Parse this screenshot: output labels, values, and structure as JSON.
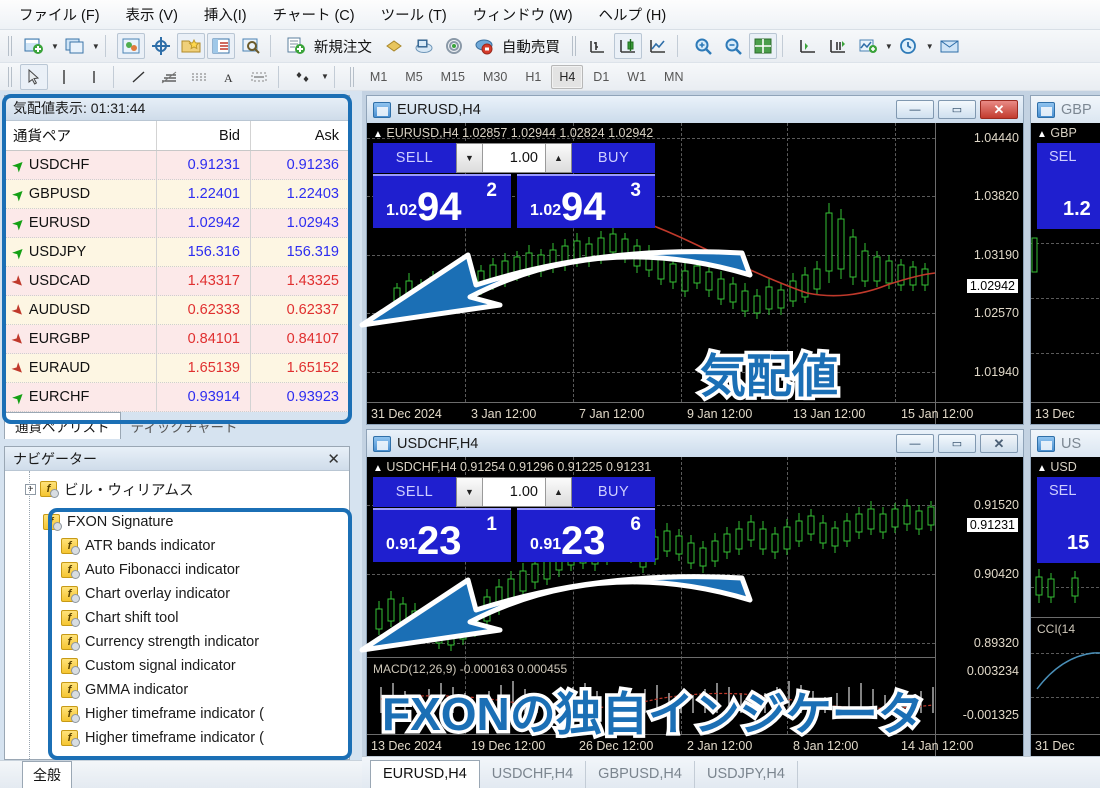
{
  "menu": {
    "items": [
      "ファイル (F)",
      "表示 (V)",
      "挿入(I)",
      "チャート (C)",
      "ツール (T)",
      "ウィンドウ (W)",
      "ヘルプ (H)"
    ]
  },
  "toolbar": {
    "new_order_label": "新規注文",
    "autotrading_label": "自動売買",
    "icons": [
      "new-chart-icon",
      "tile-windows-icon",
      "profiles-icon",
      "crosshair-icon",
      "templates-icon",
      "indicator-list-icon",
      "zoom-search-icon",
      "new-order-icon",
      "terminal-icon",
      "market-cloud-icon",
      "signals-icon",
      "expert-advisor-icon",
      "bar-chart-icon",
      "candlestick-icon",
      "line-chart-icon",
      "zoom-in-icon",
      "zoom-out-icon",
      "tile-icon",
      "shift-icon",
      "autoscroll-icon",
      "indicators-icon",
      "period-icon",
      "mail-icon"
    ]
  },
  "timeframes": {
    "items": [
      "M1",
      "M5",
      "M15",
      "M30",
      "H1",
      "H4",
      "D1",
      "W1",
      "MN"
    ],
    "selected": "H4"
  },
  "market_watch": {
    "title": "気配値表示: 01:31:44",
    "columns": [
      "通貨ペア",
      "Bid",
      "Ask"
    ],
    "rows": [
      {
        "symbol": "USDCHF",
        "bid": "0.91231",
        "ask": "0.91236",
        "dir": "up"
      },
      {
        "symbol": "GBPUSD",
        "bid": "1.22401",
        "ask": "1.22403",
        "dir": "up"
      },
      {
        "symbol": "EURUSD",
        "bid": "1.02942",
        "ask": "1.02943",
        "dir": "up"
      },
      {
        "symbol": "USDJPY",
        "bid": "156.316",
        "ask": "156.319",
        "dir": "up"
      },
      {
        "symbol": "USDCAD",
        "bid": "1.43317",
        "ask": "1.43325",
        "dir": "down"
      },
      {
        "symbol": "AUDUSD",
        "bid": "0.62333",
        "ask": "0.62337",
        "dir": "down"
      },
      {
        "symbol": "EURGBP",
        "bid": "0.84101",
        "ask": "0.84107",
        "dir": "down"
      },
      {
        "symbol": "EURAUD",
        "bid": "1.65139",
        "ask": "1.65152",
        "dir": "down"
      },
      {
        "symbol": "EURCHF",
        "bid": "0.93914",
        "ask": "0.93923",
        "dir": "up"
      }
    ],
    "tabs": [
      {
        "label": "通貨ペアリスト",
        "selected": true
      },
      {
        "label": "ティックチャート",
        "selected": false
      }
    ]
  },
  "navigator": {
    "title": "ナビゲーター",
    "close_icon": "✕",
    "group_label": "ビル・ウィリアムス",
    "folder_label": "FXON Signature",
    "items": [
      "ATR bands indicator",
      "Auto Fibonacci indicator",
      "Chart overlay indicator",
      "Chart shift tool",
      "Currency strength indicator",
      "Custom signal indicator",
      "GMMA indicator",
      "Higher timeframe indicator (",
      "Higher timeframe indicator ("
    ]
  },
  "statusbar": {
    "tab": "全般"
  },
  "charts": [
    {
      "title": "EURUSD,H4",
      "ohlc": "EURUSD,H4  1.02857 1.02944 1.02824 1.02942",
      "trade": {
        "sell_label": "SELL",
        "buy_label": "BUY",
        "volume": "1.00",
        "sell_small": "1.02",
        "sell_big": "94",
        "sell_sup": "2",
        "buy_small": "1.02",
        "buy_big": "94",
        "buy_sup": "3"
      },
      "price_ticks": [
        "1.04440",
        "1.03820",
        "1.03190",
        "1.02570",
        "1.01940"
      ],
      "current_price": "1.02942",
      "time_ticks": [
        "31 Dec 2024",
        "3 Jan 12:00",
        "7 Jan 12:00",
        "9 Jan 12:00",
        "13 Jan 12:00",
        "15 Jan 12:00"
      ],
      "window_buttons": [
        "minimize",
        "maximize",
        "close"
      ]
    },
    {
      "title": "USDCHF,H4",
      "ohlc": "USDCHF,H4  0.91254 0.91296 0.91225 0.91231",
      "trade": {
        "sell_label": "SELL",
        "buy_label": "BUY",
        "volume": "1.00",
        "sell_small": "0.91",
        "sell_big": "23",
        "sell_sup": "1",
        "buy_small": "0.91",
        "buy_big": "23",
        "buy_sup": "6"
      },
      "price_ticks": [
        "0.91520",
        "0.90420",
        "0.89320"
      ],
      "current_price": "0.91231",
      "macd_label": "MACD(12,26,9) -0.000163 0.000455",
      "macd_ticks": [
        "0.003234",
        "-0.001325"
      ],
      "time_ticks": [
        "13 Dec 2024",
        "19 Dec 12:00",
        "26 Dec 12:00",
        "2 Jan 12:00",
        "8 Jan 12:00",
        "14 Jan 12:00"
      ],
      "window_buttons": [
        "minimize",
        "maximize",
        "close"
      ]
    },
    {
      "title": "GBP",
      "ohlc": "GBP",
      "sell_label": "SEL",
      "price": "1.2",
      "time_tick": "13 Dec"
    },
    {
      "title": "US",
      "ohlc": "USD",
      "sell_label": "SEL",
      "price": "15",
      "cci_label": "CCI(14",
      "time_tick": "31 Dec"
    }
  ],
  "chart_tabs": [
    {
      "label": "EURUSD,H4",
      "selected": true
    },
    {
      "label": "USDCHF,H4",
      "selected": false
    },
    {
      "label": "GBPUSD,H4",
      "selected": false
    },
    {
      "label": "USDJPY,H4",
      "selected": false
    }
  ],
  "annotations": [
    {
      "text": "気配値",
      "target": "market-watch"
    },
    {
      "text": "FXONの独自インジケータ",
      "target": "navigator-indicators"
    }
  ],
  "colors": {
    "accent": "#1b6fb5",
    "up": "#2d2df0",
    "down": "#e03030",
    "trade_panel": "#1f1fcf"
  }
}
